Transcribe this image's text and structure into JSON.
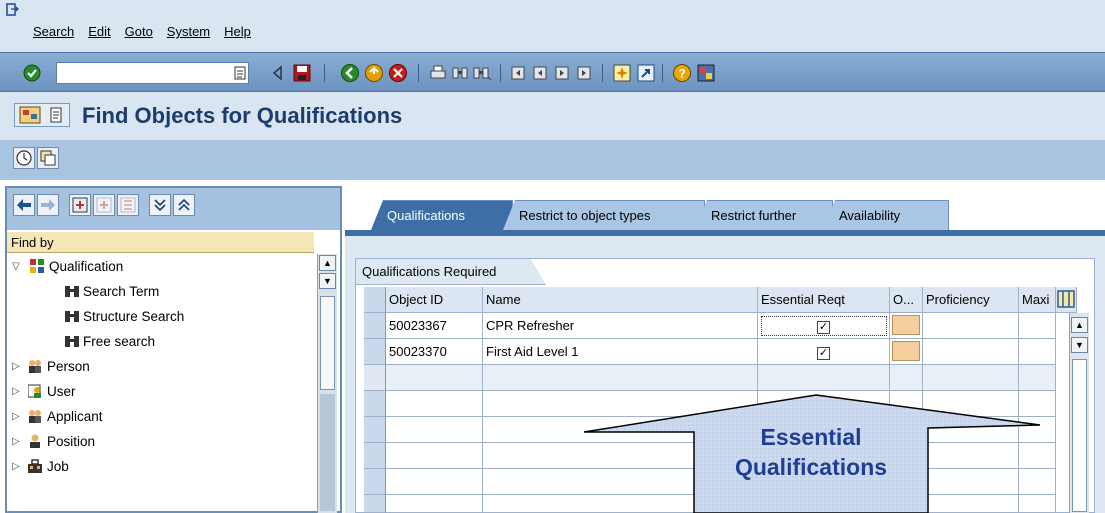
{
  "menu": {
    "items": [
      "Search",
      "Edit",
      "Goto",
      "System",
      "Help"
    ]
  },
  "toolbar": {
    "command_value": "",
    "icons": [
      "enter-icon",
      "history-icon",
      "back-icon",
      "save-icon",
      "back-green-icon",
      "exit-icon",
      "cancel-icon",
      "print-icon",
      "find-icon",
      "find-next-icon",
      "first-page-icon",
      "prev-page-icon",
      "next-page-icon",
      "last-page-icon",
      "new-session-icon",
      "shortcut-icon",
      "help-icon",
      "layout-icon"
    ]
  },
  "title": "Find Objects for Qualifications",
  "left_panel": {
    "find_by": "Find by",
    "tree": [
      {
        "label": "Qualification",
        "level": 0,
        "expanded": true,
        "icon": "qualification-icon"
      },
      {
        "label": "Search Term",
        "level": 1,
        "icon": "binoculars-icon"
      },
      {
        "label": "Structure Search",
        "level": 1,
        "icon": "binoculars-icon"
      },
      {
        "label": "Free search",
        "level": 1,
        "icon": "binoculars-icon"
      },
      {
        "label": "Person",
        "level": 0,
        "expanded": false,
        "icon": "person-icon"
      },
      {
        "label": "User",
        "level": 0,
        "expanded": false,
        "icon": "user-icon"
      },
      {
        "label": "Applicant",
        "level": 0,
        "expanded": false,
        "icon": "applicant-icon"
      },
      {
        "label": "Position",
        "level": 0,
        "expanded": false,
        "icon": "position-icon"
      },
      {
        "label": "Job",
        "level": 0,
        "expanded": false,
        "icon": "job-icon"
      }
    ]
  },
  "tabs": [
    {
      "label": "Qualifications",
      "active": true
    },
    {
      "label": "Restrict to object types",
      "active": false
    },
    {
      "label": "Restrict further",
      "active": false
    },
    {
      "label": "Availability",
      "active": false
    }
  ],
  "group": {
    "label": "Qualifications Required",
    "columns": [
      "Object ID",
      "Name",
      "Essential Reqt",
      "O...",
      "Proficiency",
      "Maxi"
    ],
    "rows": [
      {
        "object_id": "50023367",
        "name": "CPR Refresher",
        "essential": true,
        "proficiency": ""
      },
      {
        "object_id": "50023370",
        "name": "First Aid Level 1",
        "essential": true,
        "proficiency": ""
      }
    ]
  },
  "callout": {
    "line1": "Essential",
    "line2": "Qualifications"
  },
  "colors": {
    "title": "#1c3c6c",
    "tab_active": "#3d6fa6",
    "tab_inactive": "#a9c6e4",
    "callout_text": "#1e3f94",
    "find_by_bg": "#f5e6b8"
  }
}
